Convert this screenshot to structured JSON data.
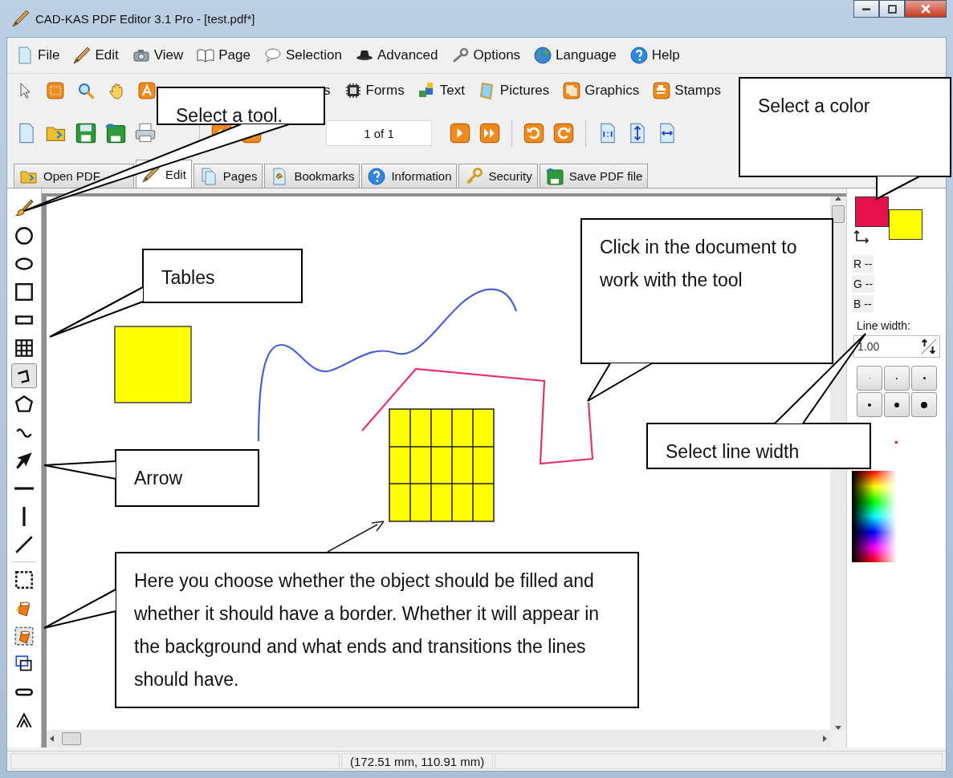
{
  "window": {
    "title": "CAD-KAS PDF Editor 3.1 Pro - [test.pdf*]"
  },
  "menu": [
    "File",
    "Edit",
    "View",
    "Page",
    "Selection",
    "Advanced",
    "Options",
    "Language",
    "Help"
  ],
  "toolbar": [
    "s",
    "Forms",
    "Text",
    "Pictures",
    "Graphics",
    "Stamps"
  ],
  "page_field": {
    "value": "1 of 1"
  },
  "tabs": [
    {
      "label": "Open PDF",
      "selected": false
    },
    {
      "label": "Edit",
      "selected": true
    },
    {
      "label": "Pages",
      "selected": false
    },
    {
      "label": "Bookmarks",
      "selected": false
    },
    {
      "label": "Information",
      "selected": false
    },
    {
      "label": "Security",
      "selected": false
    },
    {
      "label": "Save PDF file",
      "selected": false
    }
  ],
  "tools": [
    {
      "kind": "brush",
      "selected": false
    },
    {
      "kind": "circle",
      "selected": false
    },
    {
      "kind": "ellipse",
      "selected": false
    },
    {
      "kind": "square",
      "selected": false
    },
    {
      "kind": "rectangle",
      "selected": false
    },
    {
      "kind": "table",
      "selected": false
    },
    {
      "kind": "polyline",
      "selected": true
    },
    {
      "kind": "polygon",
      "selected": false
    },
    {
      "kind": "curve",
      "selected": false
    },
    {
      "kind": "arrow",
      "selected": false
    },
    {
      "kind": "horizontal-line",
      "selected": false
    },
    {
      "kind": "vertical-line",
      "selected": false
    },
    {
      "kind": "diagonal-line",
      "selected": false
    },
    {
      "kind": "border",
      "selected": false
    },
    {
      "kind": "fill",
      "selected": false
    },
    {
      "kind": "fill-border",
      "selected": false
    },
    {
      "kind": "frame",
      "selected": false
    },
    {
      "kind": "line-end",
      "selected": false
    },
    {
      "kind": "line-join",
      "selected": false
    }
  ],
  "color_panel": {
    "swatches": [
      {
        "kind": "foreground",
        "color": "#e5114b"
      },
      {
        "kind": "background",
        "color": "#ffff00"
      }
    ],
    "channels": [
      "R --",
      "G --",
      "B --"
    ],
    "line_width_label": "Line width:",
    "line_width": {
      "value": "1.00"
    }
  },
  "status_bar": {
    "coordinates": "(172.51 mm, 110.91 mm)"
  },
  "callouts": [
    "Select a tool.",
    "Select a color",
    "Tables",
    "Click in the document to work with the tool",
    "Arrow",
    "Select line width",
    "Here you choose whether the object should be filled and whether it should have a border. Whether it will appear in the background and what ends and transitions the lines should have."
  ]
}
